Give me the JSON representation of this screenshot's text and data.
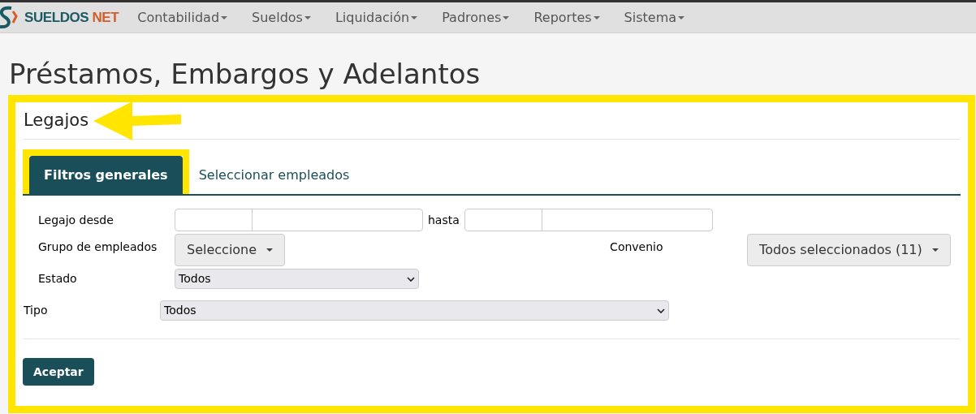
{
  "nav": {
    "brand": {
      "first": "SUELDOS",
      "second": "NET"
    },
    "menus": [
      "Contabilidad",
      "Sueldos",
      "Liquidación",
      "Padrones",
      "Reportes",
      "Sistema"
    ]
  },
  "page_title": "Préstamos, Embargos y Adelantos",
  "card": {
    "title": "Legajos",
    "tabs": [
      {
        "label": "Filtros generales",
        "selected": true
      },
      {
        "label": "Seleccionar empleados",
        "selected": false
      }
    ],
    "legajo": {
      "label": "Legajo desde",
      "to_label": "hasta"
    },
    "grupo": {
      "label": "Grupo de empleados",
      "button": "Seleccione"
    },
    "convenio": {
      "label": "Convenio",
      "button": "Todos seleccionados (11)"
    },
    "estado": {
      "label": "Estado",
      "value": "Todos"
    },
    "tipo": {
      "label": "Tipo",
      "value": "Todos"
    },
    "submit": "Aceptar"
  }
}
